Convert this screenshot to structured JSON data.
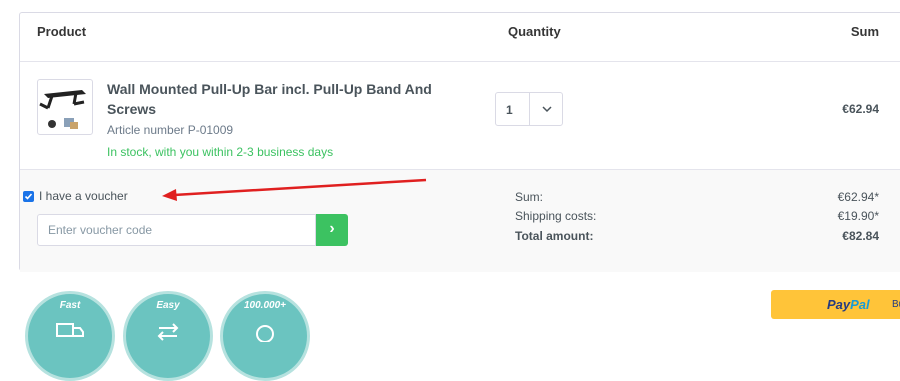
{
  "table": {
    "header_product": "Product",
    "header_quantity": "Quantity",
    "header_sum": "Sum"
  },
  "item": {
    "name": "Wall Mounted Pull-Up Bar incl. Pull-Up Band And Screws",
    "article_number": "Article number P-01009",
    "stock": "In stock, with you within 2-3 business days",
    "quantity": "1",
    "sum": "€62.94",
    "stock_color": "#3cc261"
  },
  "voucher": {
    "checkbox_label": "I have a voucher",
    "checked": true,
    "input_placeholder": "Enter voucher code",
    "submit_glyph": "›",
    "button_color": "#3cc261"
  },
  "totals": {
    "sum_label": "Sum:",
    "sum_value": "€62.94*",
    "shipping_label": "Shipping costs:",
    "shipping_value": "€19.90*",
    "total_label": "Total amount:",
    "total_value": "€82.84"
  },
  "paypal": {
    "brand_part1": "Pay",
    "brand_part2": "Pal",
    "buy_label": "Buy",
    "button_color": "#ffc439"
  },
  "badges": [
    {
      "label": "Fast",
      "icon": "truck-icon"
    },
    {
      "label": "Easy",
      "icon": "return-arrows-icon"
    },
    {
      "label": "100.000+",
      "icon": "customers-icon"
    }
  ],
  "annotation": {
    "arrow_color": "#e02020"
  }
}
